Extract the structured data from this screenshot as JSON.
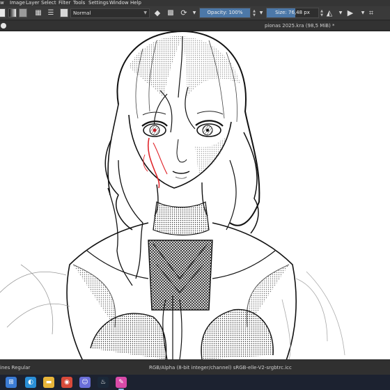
{
  "menu": [
    "w",
    "Image",
    "Layer",
    "Select",
    "Filter",
    "Tools",
    "Settings",
    "Window",
    "Help"
  ],
  "toolbar": {
    "blend_mode": "Normal",
    "opacity_label": "Opacity: 100%",
    "opacity_value": 1.0,
    "size_label": "Size: 76,48 px",
    "size_fill_fraction": 0.55
  },
  "tab": {
    "title": "pionas 2025.kra (98,5 MiB) *"
  },
  "status": {
    "brush": "ines Regular",
    "color_profile": "RGB/Alpha (8-bit integer/channel)  sRGB-elle-V2-srgbtrc.icc"
  },
  "colors": {
    "accent": "#4c78a8",
    "ui_dark": "#3a3a3a",
    "canvas": "#ffffff",
    "blood_red": "#e0242a"
  },
  "icons": {
    "eraser": "eraser-icon",
    "alpha_lock": "alpha-lock-icon",
    "reload": "reload-icon",
    "mirror": "mirror-icon",
    "play": "play-icon",
    "wrap": "wrap-icon"
  },
  "taskbar": {
    "apps": [
      "start",
      "file-explorer",
      "edge",
      "folder",
      "chrome",
      "discord",
      "steam",
      "krita"
    ]
  }
}
